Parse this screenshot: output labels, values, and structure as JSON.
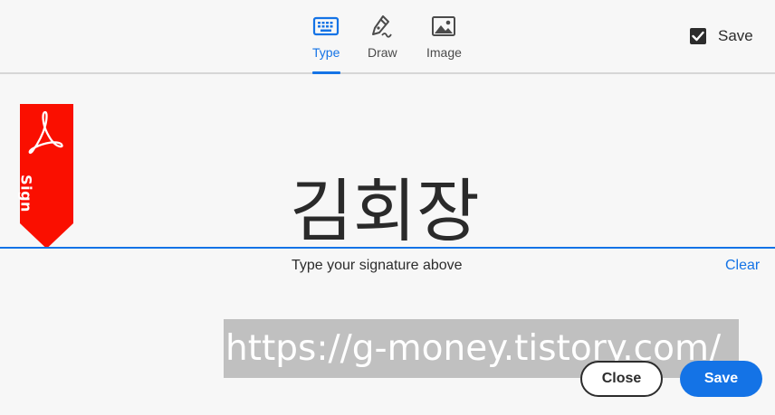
{
  "tabs": [
    {
      "label": "Type",
      "icon": "keyboard-icon",
      "active": true
    },
    {
      "label": "Draw",
      "icon": "pen-icon",
      "active": false
    },
    {
      "label": "Image",
      "icon": "image-icon",
      "active": false
    }
  ],
  "save_toggle": {
    "label": "Save",
    "checked": true
  },
  "sign_flag": {
    "label": "Sign",
    "color": "#fa0f00",
    "icon": "acrobat-logo-icon"
  },
  "signature": {
    "text": "김회장",
    "hint": "Type your signature above",
    "clear_label": "Clear"
  },
  "watermark": {
    "text": "https://g-money.tistory.com/"
  },
  "actions": {
    "close_label": "Close",
    "save_label": "Save"
  },
  "colors": {
    "accent": "#1473e6",
    "text": "#2c2c2c",
    "background": "#f7f7f7"
  }
}
